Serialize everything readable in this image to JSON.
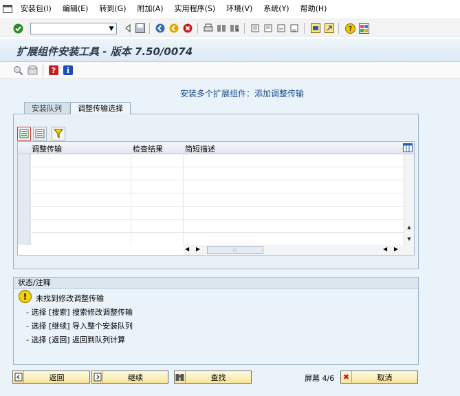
{
  "menu": {
    "items": [
      "安装包(I)",
      "编辑(E)",
      "转到(G)",
      "附加(A)",
      "实用程序(S)",
      "环境(V)",
      "系统(Y)",
      "帮助(H)"
    ]
  },
  "toolbar": {
    "command_value": ""
  },
  "window": {
    "title": "扩展组件安装工具 - 版本 7.50/0074"
  },
  "main": {
    "subtitle": "安装多个扩展组件：添加调整传输",
    "tabs": [
      {
        "label": "安装队列",
        "active": false
      },
      {
        "label": "调整传输选择",
        "active": true
      }
    ],
    "table": {
      "columns": [
        "调整传输",
        "检查结果",
        "简短描述"
      ],
      "rows": [
        [
          "",
          "",
          ""
        ],
        [
          "",
          "",
          ""
        ],
        [
          "",
          "",
          ""
        ],
        [
          "",
          "",
          ""
        ],
        [
          "",
          "",
          ""
        ],
        [
          "",
          "",
          ""
        ],
        [
          "",
          "",
          ""
        ]
      ],
      "hscroll_thumb": ":::"
    }
  },
  "status": {
    "header": "状态/注释",
    "warning_symbol": "!",
    "message": "未找到修改调整传输",
    "hints": [
      "- 选择 [搜索] 搜索修改调整传输",
      "- 选择 [继续] 导入整个安装队列",
      "- 选择 [返回] 返回到队列计算"
    ]
  },
  "footer": {
    "back_label": "返回",
    "continue_label": "继续",
    "search_label": "查找",
    "screen_info": "屏幕 4/6",
    "cancel_label": "取消",
    "cancel_icon_symbol": "✖"
  },
  "colors": {
    "subtitle": "#1a4d8c",
    "button_bg": "#f7e49a",
    "warning": "#f5d300",
    "cancel_icon": "#d01010",
    "help_icon": "#c41e1e",
    "info_icon": "#1a4fb5"
  },
  "icons": {
    "system": "system-menu-icon",
    "enter": "enter-checkmark-icon",
    "help": "help-icon",
    "info": "info-icon"
  }
}
